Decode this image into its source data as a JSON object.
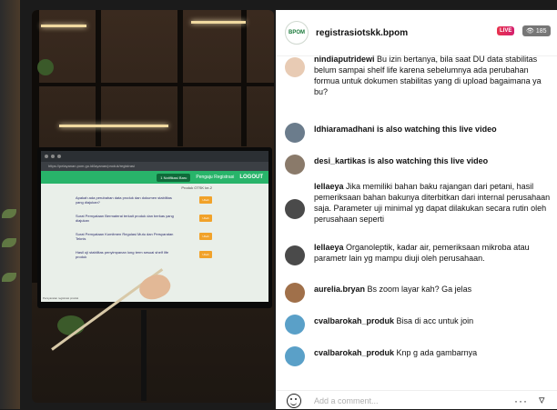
{
  "header": {
    "username": "registrasiotskk.bpom",
    "live_label": "LIVE",
    "viewers": "185",
    "avatar_text": "BPOM"
  },
  "screen": {
    "url": "https://pelayanan.pom.go.id/layanan/produk/registrasi",
    "notif": "1 Notifikasi Baru",
    "user": "Pengaju Registrasi",
    "logout": "LOGOUT",
    "form_header": "Produk OTSK ke-2",
    "questions": [
      {
        "text": "Apakah ada perubahan data produk dan dokumen stabilitas yang diajukan?",
        "button": "Ubah"
      },
      {
        "text": "Surat Pernyataan Bermaterai terkait produk dan berkas yang diajukan",
        "button": "Ubah"
      },
      {
        "text": "Surat Pernyataan Komitmen Regulasi Mutu dan Persyaratan Teknis",
        "button": "Ubah"
      },
      {
        "text": "Hasil uji stabilitas penyimpanan long term sesuai shelf life produk",
        "button": "Ubah"
      }
    ],
    "footer_text": "Persyaratan registrasi produk"
  },
  "comments": [
    {
      "user": "nindiaputridewi",
      "text": "Bu izin bertanya, bila saat DU data stabilitas belum sampai shelf life karena sebelumnya ada perubahan formua untuk dokumen stabilitas yang di upload bagaimana ya bu?",
      "avatar_color": "#e8cbb4"
    },
    {
      "user": "ldhiaramadhani",
      "text": "is also watching this live video",
      "avatar_color": "#6b7c8c"
    },
    {
      "user": "desi_kartikas",
      "text": "is also watching this live video",
      "avatar_color": "#8a7a6a"
    },
    {
      "user": "lellaeya",
      "text": "Jika memiliki bahan baku rajangan dari petani, hasil pemeriksaan bahan bakunya diterbitkan dari internal perusahaan saja. Parameter uji minimal yg dapat dilakukan secara rutin oleh perusahaan seperti",
      "avatar_color": "#4a4a4a"
    },
    {
      "user": "lellaeya",
      "text": "Organoleptik, kadar air, pemeriksaan mikroba atau parametr lain yg mampu diuji oleh perusahaan.",
      "avatar_color": "#4a4a4a"
    },
    {
      "user": "aurelia.bryan",
      "text": "Bs zoom layar kah? Ga jelas",
      "avatar_color": "#a0704a"
    },
    {
      "user": "cvalbarokah_produk",
      "text": "Bisa di acc untuk join",
      "avatar_color": "#5aa0c8"
    },
    {
      "user": "cvalbarokah_produk",
      "text": "Knp g ada gambarnya",
      "avatar_color": "#5aa0c8"
    }
  ],
  "footer": {
    "placeholder": "Add a comment...",
    "more": "···",
    "send_icon": "send-icon"
  }
}
